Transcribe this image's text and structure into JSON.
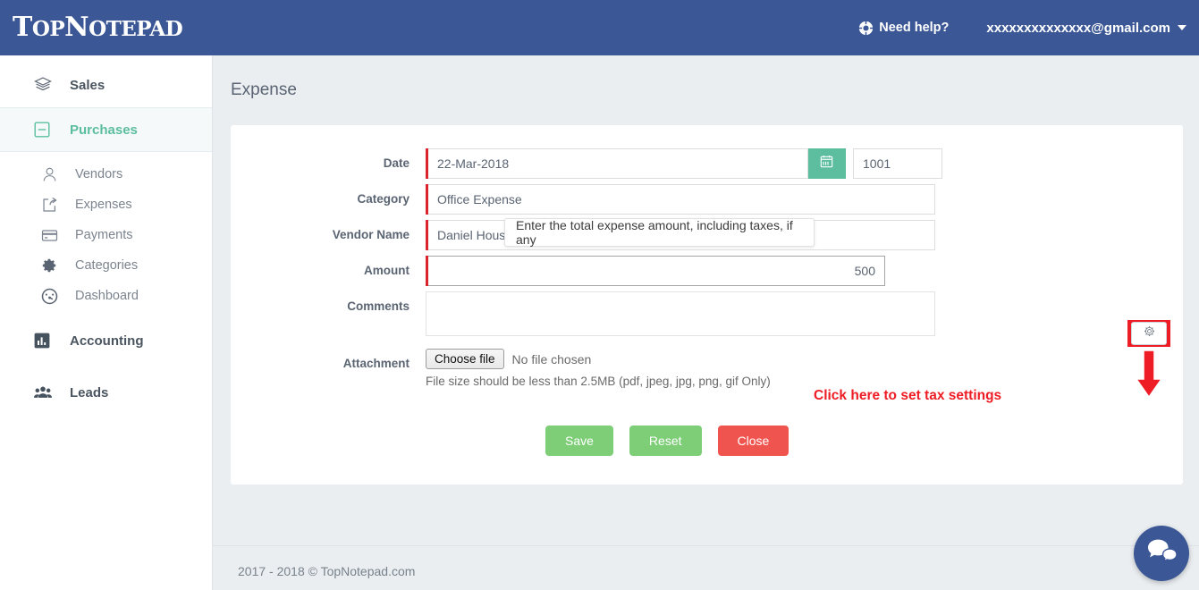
{
  "header": {
    "logo_top": "T",
    "logo_op": "OP",
    "logo_n": "N",
    "logo_otepad": "OTEPAD",
    "logo_full": "TopNotepad",
    "help_label": "Need help?",
    "help_icon": "life-ring-icon",
    "user_email": "xxxxxxxxxxxxxx@gmail.com",
    "caret_icon": "chevron-down-icon",
    "bg_color": "#3b5796"
  },
  "sidebar": {
    "items": [
      {
        "label": "Sales",
        "icon": "layers-icon",
        "level": "top",
        "active": false
      },
      {
        "label": "Purchases",
        "icon": "minus-square-icon",
        "level": "top",
        "active": true
      },
      {
        "label": "Vendors",
        "icon": "user-outline-icon",
        "level": "sub",
        "active": false
      },
      {
        "label": "Expenses",
        "icon": "share-arrow-icon",
        "level": "sub",
        "active": false
      },
      {
        "label": "Payments",
        "icon": "credit-card-icon",
        "level": "sub",
        "active": false
      },
      {
        "label": "Categories",
        "icon": "gear-icon",
        "level": "sub",
        "active": false
      },
      {
        "label": "Dashboard",
        "icon": "gauge-icon",
        "level": "sub",
        "active": false
      },
      {
        "label": "Accounting",
        "icon": "bar-chart-icon",
        "level": "top",
        "active": false
      },
      {
        "label": "Leads",
        "icon": "users-icon",
        "level": "top",
        "active": false
      }
    ],
    "active_color": "#5cbe9e"
  },
  "main": {
    "page_title": "Expense",
    "form": {
      "date": {
        "label": "Date",
        "value": "22-Mar-2018",
        "calendar_icon": "calendar-icon",
        "required": true
      },
      "number": {
        "value": "1001"
      },
      "category": {
        "label": "Category",
        "value": "Office Expense",
        "required": true
      },
      "vendor": {
        "label": "Vendor Name",
        "value": "Daniel House Keeping Services",
        "required": true
      },
      "amount": {
        "label": "Amount",
        "value": "500",
        "required": true
      },
      "comments": {
        "label": "Comments",
        "value": "",
        "placeholder": ""
      },
      "attachment": {
        "label": "Attachment",
        "choose_button": "Choose file",
        "no_file_text": "No file chosen",
        "hint": "File size should be less than 2.5MB (pdf, jpeg, jpg, png, gif Only)"
      },
      "tax_settings_icon": "gear-icon"
    },
    "tooltip": {
      "text": "Enter the total expense amount, including taxes, if any"
    },
    "buttons": {
      "save": "Save",
      "reset": "Reset",
      "close": "Close",
      "save_color": "#7ece78",
      "reset_color": "#7ece78",
      "close_color": "#f0544f"
    },
    "annotation": {
      "text": "Click here to set tax settings",
      "color": "#ee1c24",
      "arrow_icon": "down-arrow-icon",
      "highlight_icon": "red-box-highlight"
    }
  },
  "footer": {
    "text": "2017 - 2018 © TopNotepad.com"
  },
  "chat": {
    "icon": "chat-bubbles-icon",
    "color": "#3b5796"
  }
}
